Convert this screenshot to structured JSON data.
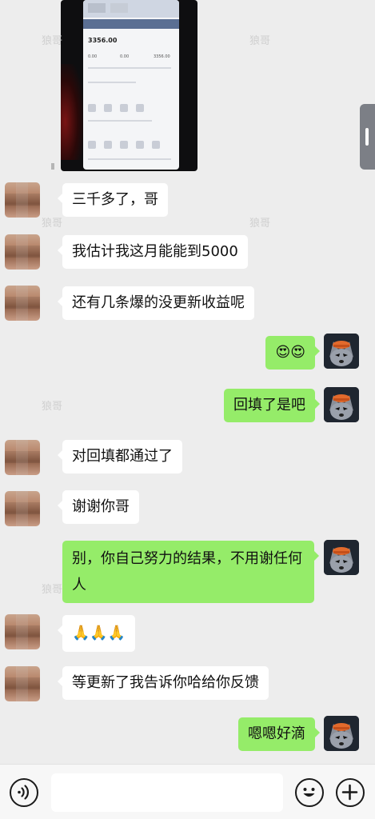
{
  "shared_image": {
    "amount": "3356.00",
    "balance_small": "3356.00",
    "zero_a": "0.00",
    "zero_b": "0.00"
  },
  "watermark": "狼哥",
  "messages": [
    {
      "side": "left",
      "text": "三千多了，哥"
    },
    {
      "side": "left",
      "text": "我估计我这月能能到5000"
    },
    {
      "side": "left",
      "text": "还有几条爆的没更新收益呢"
    },
    {
      "side": "right",
      "text": "😍😍"
    },
    {
      "side": "right",
      "text": "回填了是吧"
    },
    {
      "side": "left",
      "text": "对回填都通过了"
    },
    {
      "side": "left",
      "text": "谢谢你哥"
    },
    {
      "side": "right",
      "text": "别，你自己努力的结果，不用谢任何人"
    },
    {
      "side": "left",
      "text": "🙏🙏🙏"
    },
    {
      "side": "left",
      "text": "等更新了我告诉你哈给你反馈"
    },
    {
      "side": "right",
      "text": "嗯嗯好滴"
    }
  ],
  "input_bar": {
    "voice_icon": "voice-icon",
    "emoji_icon": "emoji-icon",
    "add_icon": "plus-icon",
    "input_value": ""
  },
  "colors": {
    "bubble_right": "#95ec69",
    "bubble_left": "#ffffff",
    "background": "#ededed"
  }
}
